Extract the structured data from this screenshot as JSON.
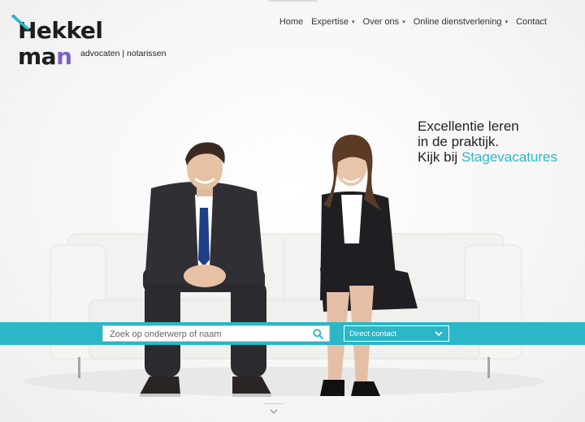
{
  "logo": {
    "word1": "Hekkel",
    "word2_part1": "ma",
    "word2_part2": "n",
    "tagline": "advocaten | notarissen"
  },
  "nav": {
    "items": [
      {
        "label": "Home",
        "has_dropdown": false
      },
      {
        "label": "Expertise",
        "has_dropdown": true
      },
      {
        "label": "Over ons",
        "has_dropdown": true
      },
      {
        "label": "Online dienstverlening",
        "has_dropdown": true
      },
      {
        "label": "Contact",
        "has_dropdown": false
      }
    ],
    "dropdown_caret": "▾"
  },
  "headline": {
    "line1": "Excellentie leren",
    "line2": "in de praktijk.",
    "line3_prefix": "Kijk bij ",
    "line3_link": "Stagevacatures"
  },
  "search": {
    "placeholder": "Zoek op onderwerp of naam",
    "value": ""
  },
  "contact_select": {
    "selected": "Direct contact"
  },
  "icons": {
    "search": "search-icon",
    "select": "chevron-down-icon",
    "scroll": "chevron-down-icon"
  },
  "colors": {
    "accent_teal": "#2ab7c7",
    "logo_purple": "#7b5fc7",
    "text_dark": "#222222"
  }
}
